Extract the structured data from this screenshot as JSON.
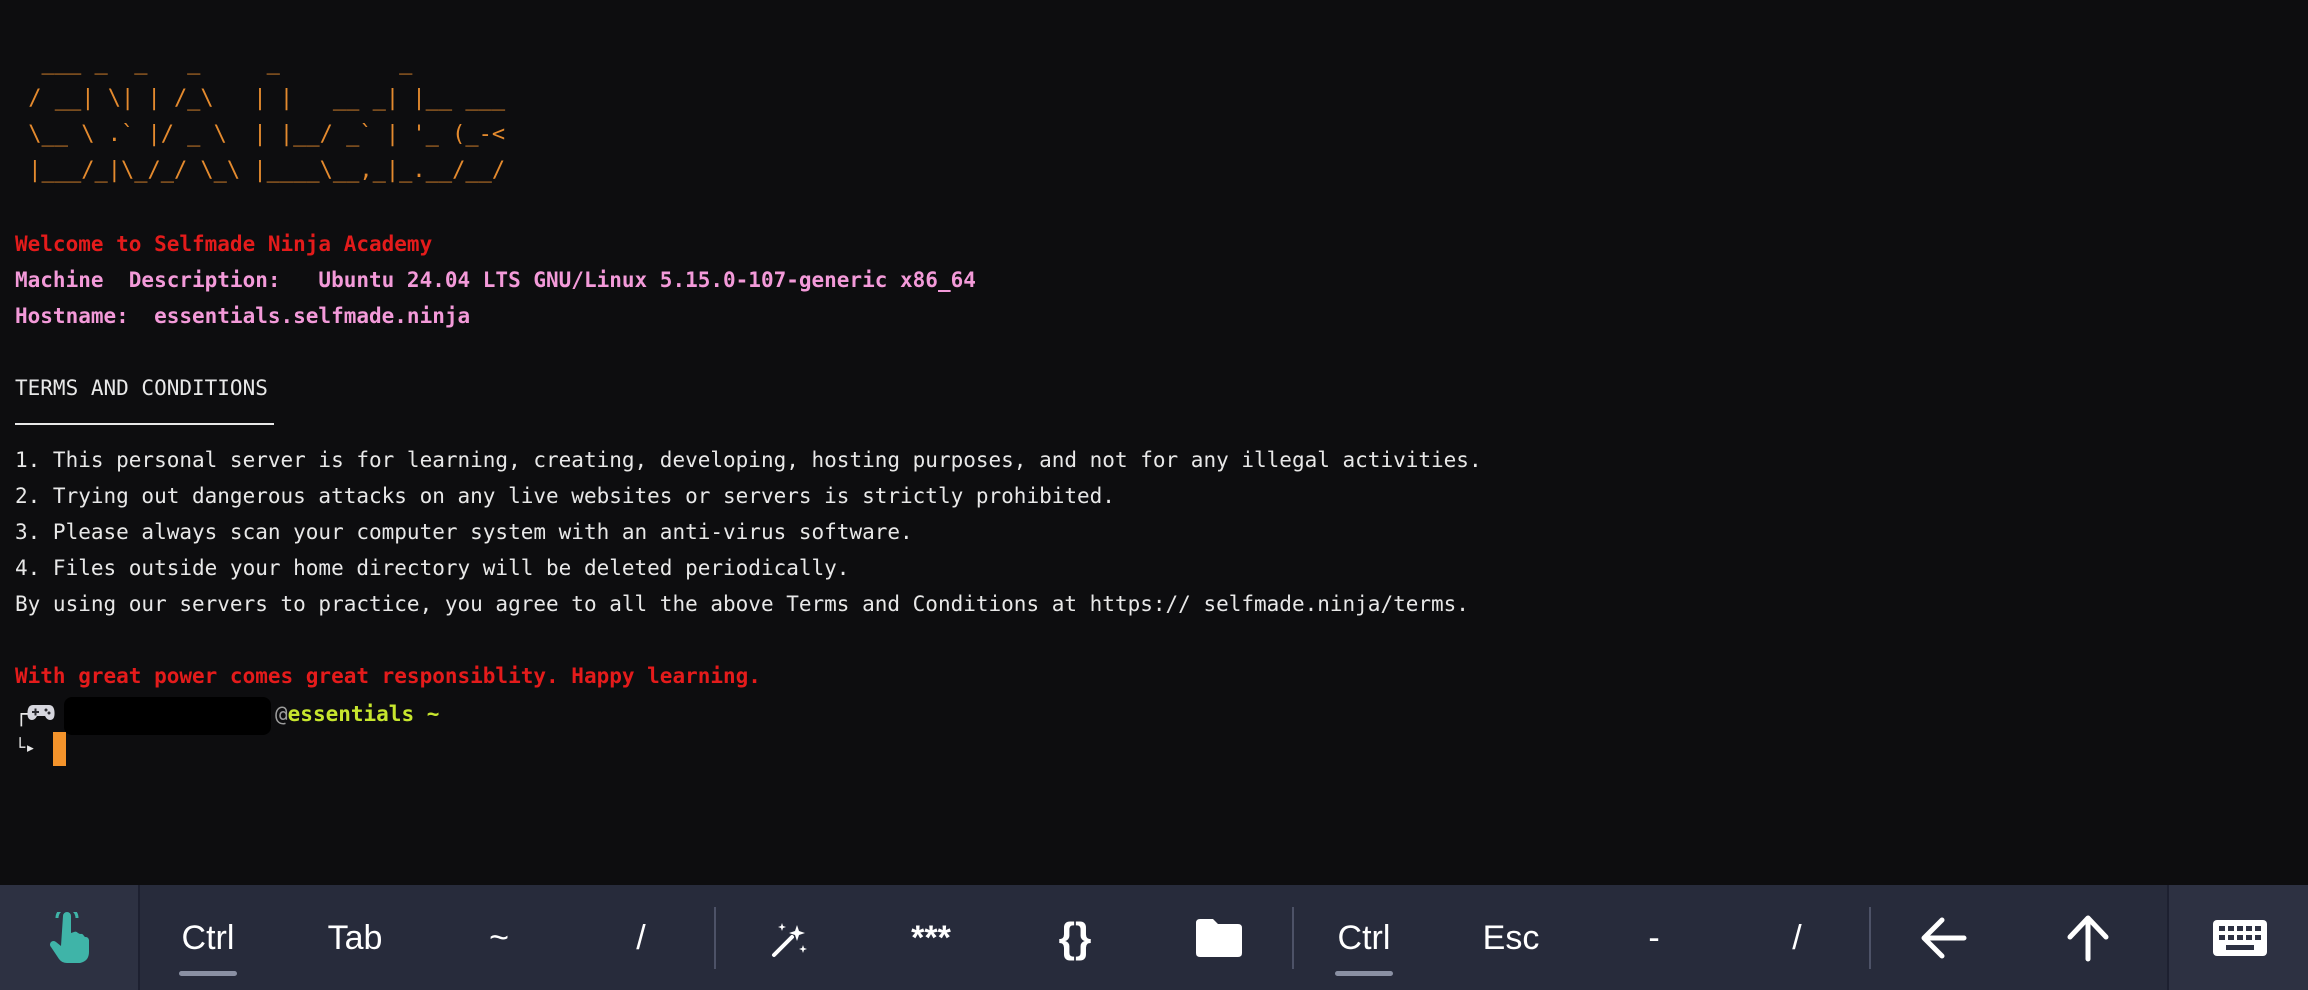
{
  "terminal": {
    "banner": [
      "  ___ _  _   _     _         _",
      " / __| \\| | /_\\   | |   __ _| |__ ___",
      " \\__ \\ .` |/ _ \\  | |__/ _` | '_ (_-<",
      " |___/_|\\_/_/ \\_\\ |____\\__,_|_.__/__/"
    ],
    "welcome": "Welcome to Selfmade Ninja Academy",
    "machine_description": "Machine  Description:   Ubuntu 24.04 LTS GNU/Linux 5.15.0-107-generic x86_64",
    "hostname": "Hostname:  essentials.selfmade.ninja",
    "terms_heading": "TERMS AND CONDITIONS",
    "terms": [
      "1. This personal server is for learning, creating, developing, hosting purposes, and not for any illegal activities.",
      "2. Trying out dangerous attacks on any live websites or servers is strictly prohibited.",
      "3. Please always scan your computer system with an anti-virus software.",
      "4. Files outside your home directory will be deleted periodically.",
      "By using our servers to practice, you agree to all the above Terms and Conditions at https:// selfmade.ninja/terms."
    ],
    "motto": "With great power comes great responsiblity. Happy learning.",
    "prompt": {
      "corner_top": "┌",
      "corner_bottom": "└▸",
      "at_sign": "@",
      "host": "essentials",
      "path": " ~"
    },
    "colors": {
      "banner": "#e48a2e",
      "red": "#e41b1b",
      "pink": "#f39ad9",
      "host": "#c7e62e",
      "cursor": "#f3932b"
    }
  },
  "toolbar": {
    "touch_icon": "touch-hand-icon",
    "keys": [
      {
        "label": "Ctrl",
        "underlined": true
      },
      {
        "label": "Tab"
      },
      {
        "label": "~"
      },
      {
        "label": "/"
      },
      {
        "icon": "magic-wand-icon"
      },
      {
        "label": "***"
      },
      {
        "label": "{}"
      },
      {
        "icon": "folder-icon"
      },
      {
        "label": "Ctrl",
        "underlined": true
      },
      {
        "label": "Esc"
      },
      {
        "label": "-"
      },
      {
        "label": "/"
      },
      {
        "icon": "arrow-left-icon"
      },
      {
        "icon": "arrow-up-icon"
      }
    ],
    "keyboard_icon": "keyboard-icon",
    "colors": {
      "background": "#272b3b",
      "touch_accent": "#3fb4a8"
    }
  }
}
